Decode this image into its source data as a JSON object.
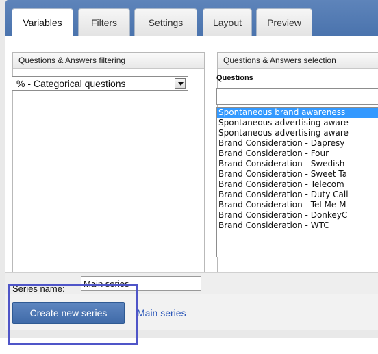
{
  "tabs": [
    {
      "label": "Variables",
      "active": true
    },
    {
      "label": "Filters",
      "active": false
    },
    {
      "label": "Settings",
      "active": false
    },
    {
      "label": "Layout",
      "active": false
    },
    {
      "label": "Preview",
      "active": false
    }
  ],
  "left_panel": {
    "title": "Questions & Answers filtering",
    "select_value": "% - Categorical questions"
  },
  "right_panel": {
    "title": "Questions & Answers selection",
    "questions_label": "Questions",
    "search_value": "",
    "questions": [
      {
        "label": "Spontaneous brand awareness",
        "selected": true
      },
      {
        "label": "Spontaneous advertising aware",
        "selected": false
      },
      {
        "label": "Spontaneous advertising aware",
        "selected": false
      },
      {
        "label": "Brand Consideration - Dapresy",
        "selected": false
      },
      {
        "label": "Brand Consideration - Four",
        "selected": false
      },
      {
        "label": "Brand Consideration - Swedish",
        "selected": false
      },
      {
        "label": "Brand Consideration - Sweet Ta",
        "selected": false
      },
      {
        "label": "Brand Consideration - Telecom",
        "selected": false
      },
      {
        "label": "Brand Consideration - Duty Call",
        "selected": false
      },
      {
        "label": "Brand Consideration - Tel Me M",
        "selected": false
      },
      {
        "label": "Brand Consideration - DonkeyC",
        "selected": false
      },
      {
        "label": "Brand Consideration - WTC",
        "selected": false
      }
    ]
  },
  "series": {
    "name_label": "Series name:",
    "name_value": "Main series"
  },
  "actions": {
    "create_label": "Create new series",
    "series_link": "Main series"
  },
  "colors": {
    "tabbar": "#4a73ad",
    "selection": "#3399ff",
    "button": "#4f77b3",
    "link": "#2a56b8",
    "highlight": "#4f55c8"
  }
}
